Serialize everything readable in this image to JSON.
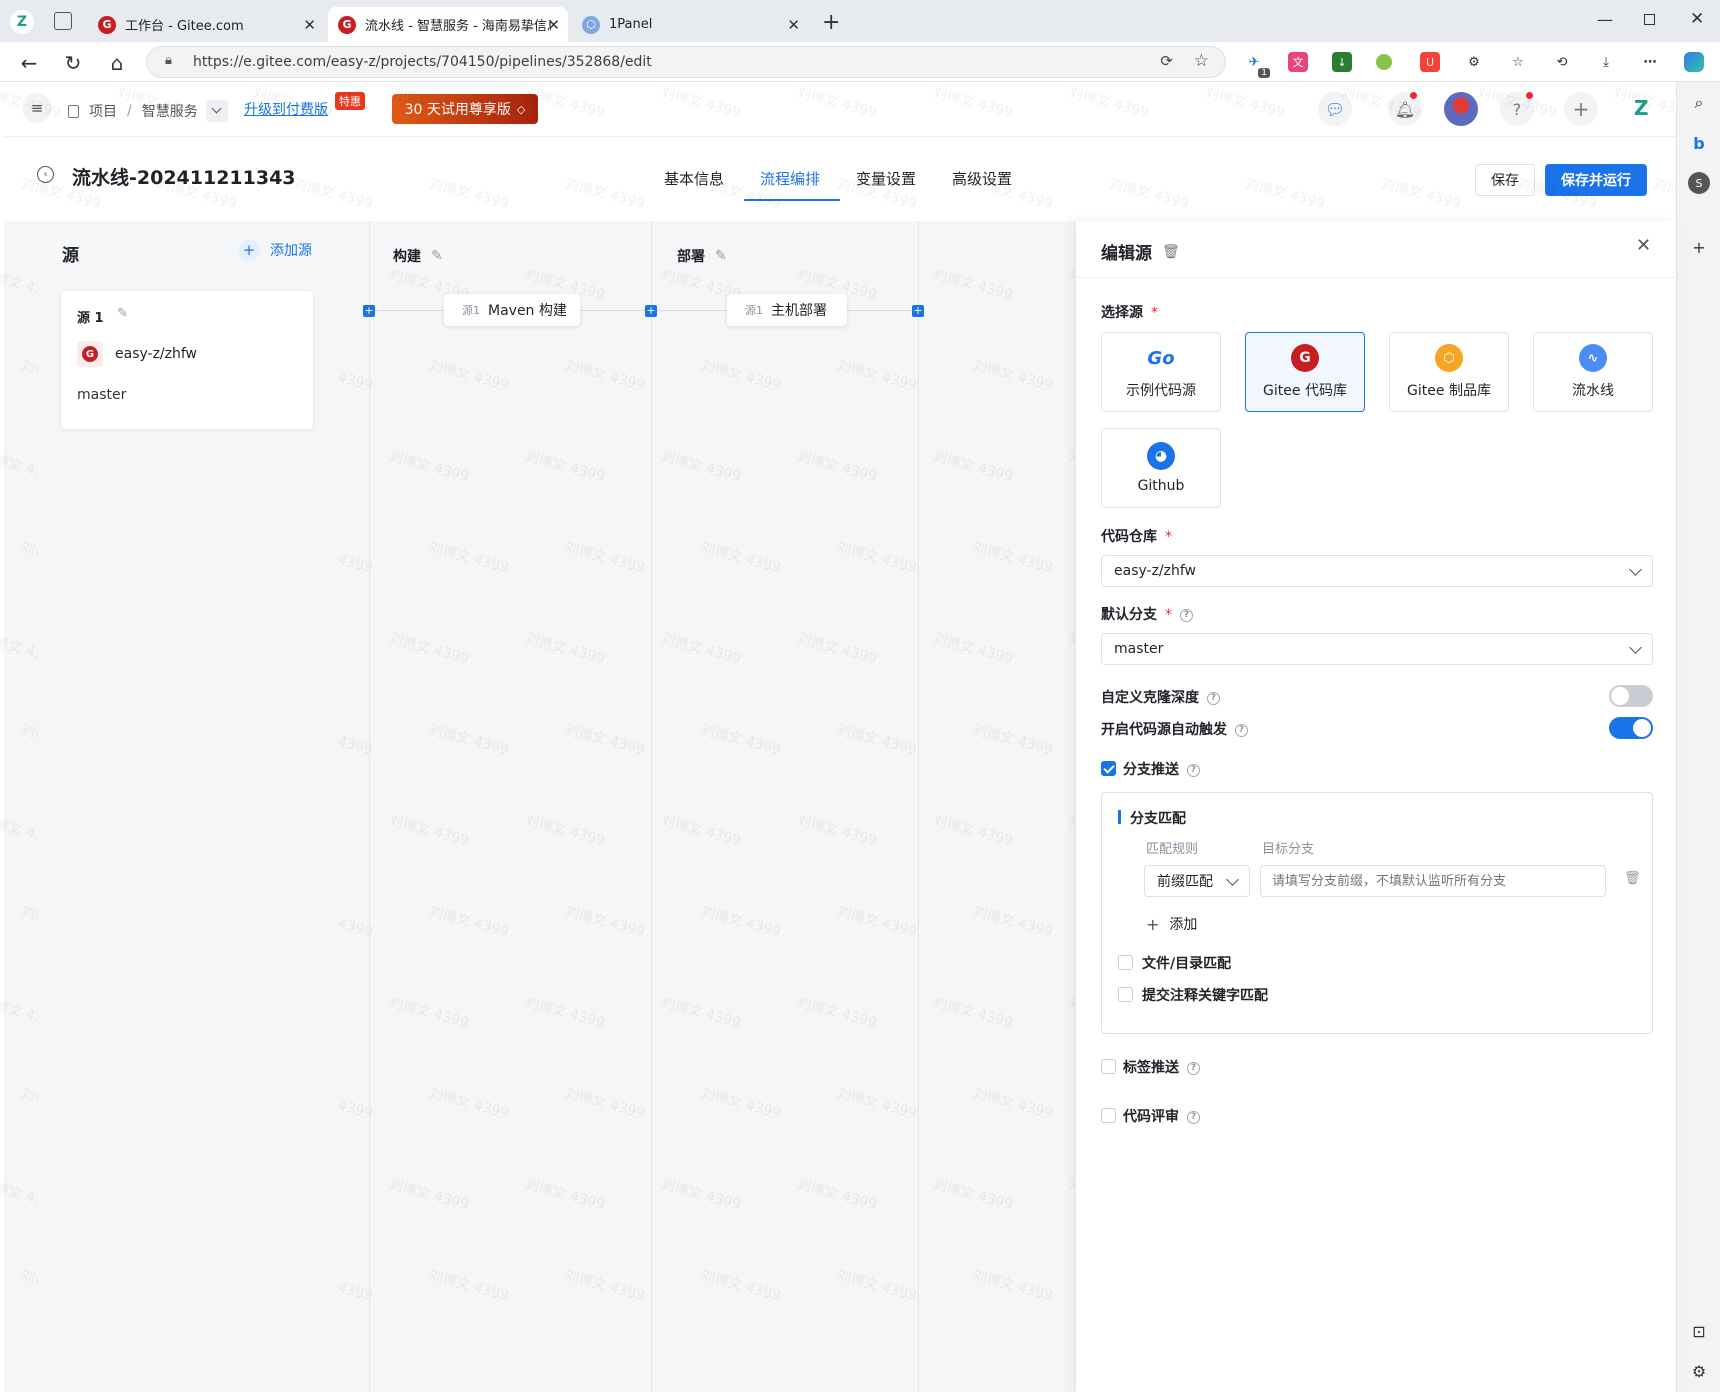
{
  "browser": {
    "tabs": [
      {
        "title": "工作台 - Gitee.com"
      },
      {
        "title": "流水线 - 智慧服务 - 海南易挚信息"
      },
      {
        "title": "1Panel"
      }
    ],
    "url": "https://e.gitee.com/easy-z/projects/704150/pipelines/352868/edit",
    "ext_badge": "1"
  },
  "header": {
    "breadcrumb_project": "项目",
    "breadcrumb_sep": "/",
    "breadcrumb_service": "智慧服务",
    "upgrade_link": "升级到付费版",
    "upgrade_badge": "特惠",
    "trial_button": "30 天试用尊享版"
  },
  "page": {
    "title": "流水线-202411211343",
    "tabs": [
      "基本信息",
      "流程编排",
      "变量设置",
      "高级设置"
    ],
    "active_tab": 1,
    "save_label": "保存",
    "save_run_label": "保存并运行"
  },
  "pipeline": {
    "source_col_title": "源",
    "add_source": "添加源",
    "source_card": {
      "title": "源 1",
      "repo": "easy-z/zhfw",
      "branch": "master"
    },
    "stages": [
      {
        "title": "构建",
        "job_prefix": "源1",
        "job": "Maven 构建"
      },
      {
        "title": "部署",
        "job_prefix": "源1",
        "job": "主机部署"
      }
    ]
  },
  "panel": {
    "title": "编辑源",
    "select_source_label": "选择源",
    "source_options": [
      "示例代码源",
      "Gitee 代码库",
      "Gitee 制品库",
      "流水线",
      "Github"
    ],
    "selected_source": 1,
    "repo_label": "代码仓库",
    "repo_value": "easy-z/zhfw",
    "branch_label": "默认分支",
    "branch_value": "master",
    "clone_depth_label": "自定义克隆深度",
    "clone_depth_on": false,
    "auto_trigger_label": "开启代码源自动触发",
    "auto_trigger_on": true,
    "branch_push_label": "分支推送",
    "branch_match_title": "分支匹配",
    "match_rule_header": "匹配规则",
    "target_branch_header": "目标分支",
    "match_rule_value": "前缀匹配",
    "target_branch_placeholder": "请填写分支前缀，不填默认监听所有分支",
    "add_label": "添加",
    "file_match_label": "文件/目录匹配",
    "commit_keyword_label": "提交注释关键字匹配",
    "tag_push_label": "标签推送",
    "code_review_label": "代码评审"
  },
  "watermark_text": "刘博文 4399",
  "colors": {
    "accent": "#1a73e8",
    "gitee_red": "#c71d23",
    "trial_orange": "#d9480f"
  }
}
